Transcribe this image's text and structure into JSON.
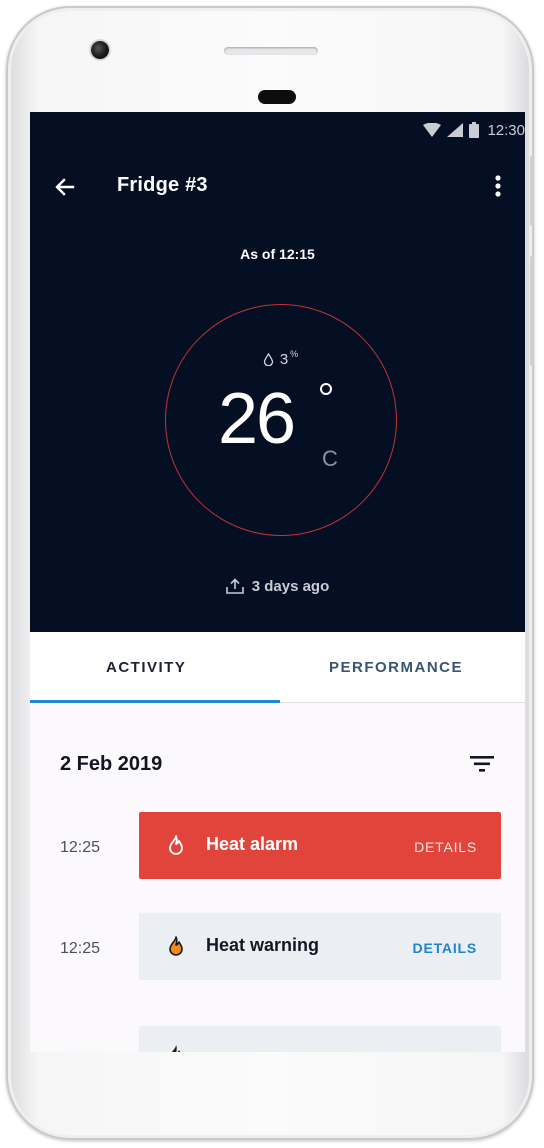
{
  "status_bar": {
    "time": "12:30",
    "icons": [
      "wifi-icon",
      "signal-icon",
      "battery-icon"
    ]
  },
  "toolbar": {
    "title": "Fridge #3",
    "back_icon": "arrow-back-icon",
    "menu_icon": "more-vert-icon"
  },
  "reading": {
    "as_of": "As of 12:15",
    "humidity_value": "3",
    "humidity_unit": "%",
    "temperature": "26",
    "temperature_unit": "C",
    "alert_color": "#c0332e",
    "last_sync": "3 days ago"
  },
  "tabs": [
    {
      "label": "ACTIVITY",
      "selected": true
    },
    {
      "label": "PERFORMANCE",
      "selected": false
    }
  ],
  "activity": {
    "date": "2 Feb 2019",
    "filter_icon": "filter-icon",
    "events": [
      {
        "time": "12:25",
        "label": "Heat alarm",
        "action": "DETAILS",
        "severity": "alarm",
        "color": "#e1443a",
        "icon": "flame-icon"
      },
      {
        "time": "12:25",
        "label": "Heat warning",
        "action": "DETAILS",
        "severity": "warning",
        "color": "#ebeef2",
        "icon": "flame-icon"
      }
    ]
  },
  "colors": {
    "header_bg": "#050f23",
    "accent": "#1f8ad6"
  }
}
